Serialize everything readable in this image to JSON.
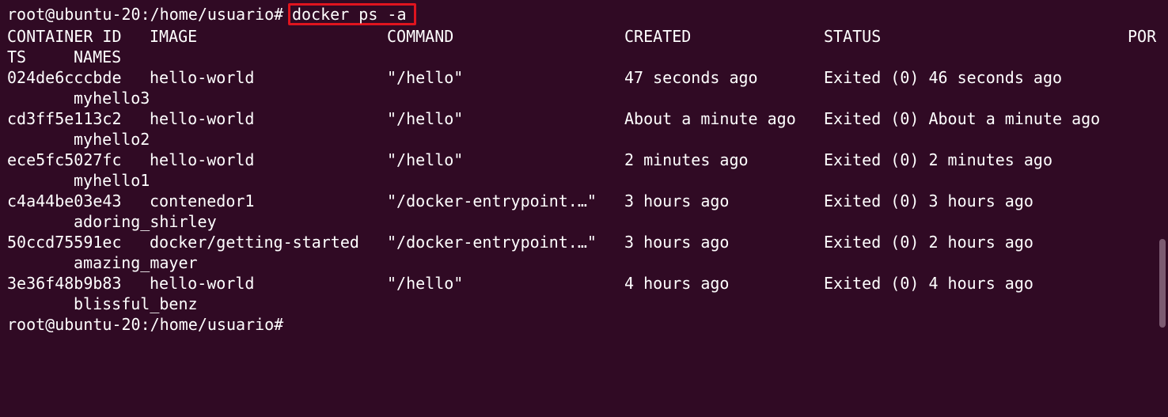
{
  "terminal": {
    "prompt": "root@ubuntu-20:/home/usuario#",
    "command": "docker ps -a",
    "highlight_color": "#e0141e",
    "background_color": "#300a24"
  },
  "headers": {
    "container_id": "CONTAINER ID",
    "image": "IMAGE",
    "command": "COMMAND",
    "created": "CREATED",
    "status": "STATUS",
    "ports_part1": "POR",
    "ports_part2": "TS",
    "names": "NAMES"
  },
  "rows": [
    {
      "id": "024de6cccbde",
      "image": "hello-world",
      "command": "\"/hello\"",
      "created": "47 seconds ago",
      "status": "Exited (0) 46 seconds ago",
      "name": "myhello3"
    },
    {
      "id": "cd3ff5e113c2",
      "image": "hello-world",
      "command": "\"/hello\"",
      "created": "About a minute ago",
      "status": "Exited (0) About a minute ago",
      "name": "myhello2"
    },
    {
      "id": "ece5fc5027fc",
      "image": "hello-world",
      "command": "\"/hello\"",
      "created": "2 minutes ago",
      "status": "Exited (0) 2 minutes ago",
      "name": "myhello1"
    },
    {
      "id": "c4a44be03e43",
      "image": "contenedor1",
      "command": "\"/docker-entrypoint.…\"",
      "created": "3 hours ago",
      "status": "Exited (0) 3 hours ago",
      "name": "adoring_shirley"
    },
    {
      "id": "50ccd75591ec",
      "image": "docker/getting-started",
      "command": "\"/docker-entrypoint.…\"",
      "created": "3 hours ago",
      "status": "Exited (0) 2 hours ago",
      "name": "amazing_mayer"
    },
    {
      "id": "3e36f48b9b83",
      "image": "hello-world",
      "command": "\"/hello\"",
      "created": "4 hours ago",
      "status": "Exited (0) 4 hours ago",
      "name": "blissful_benz"
    }
  ],
  "final_prompt": "root@ubuntu-20:/home/usuario#"
}
